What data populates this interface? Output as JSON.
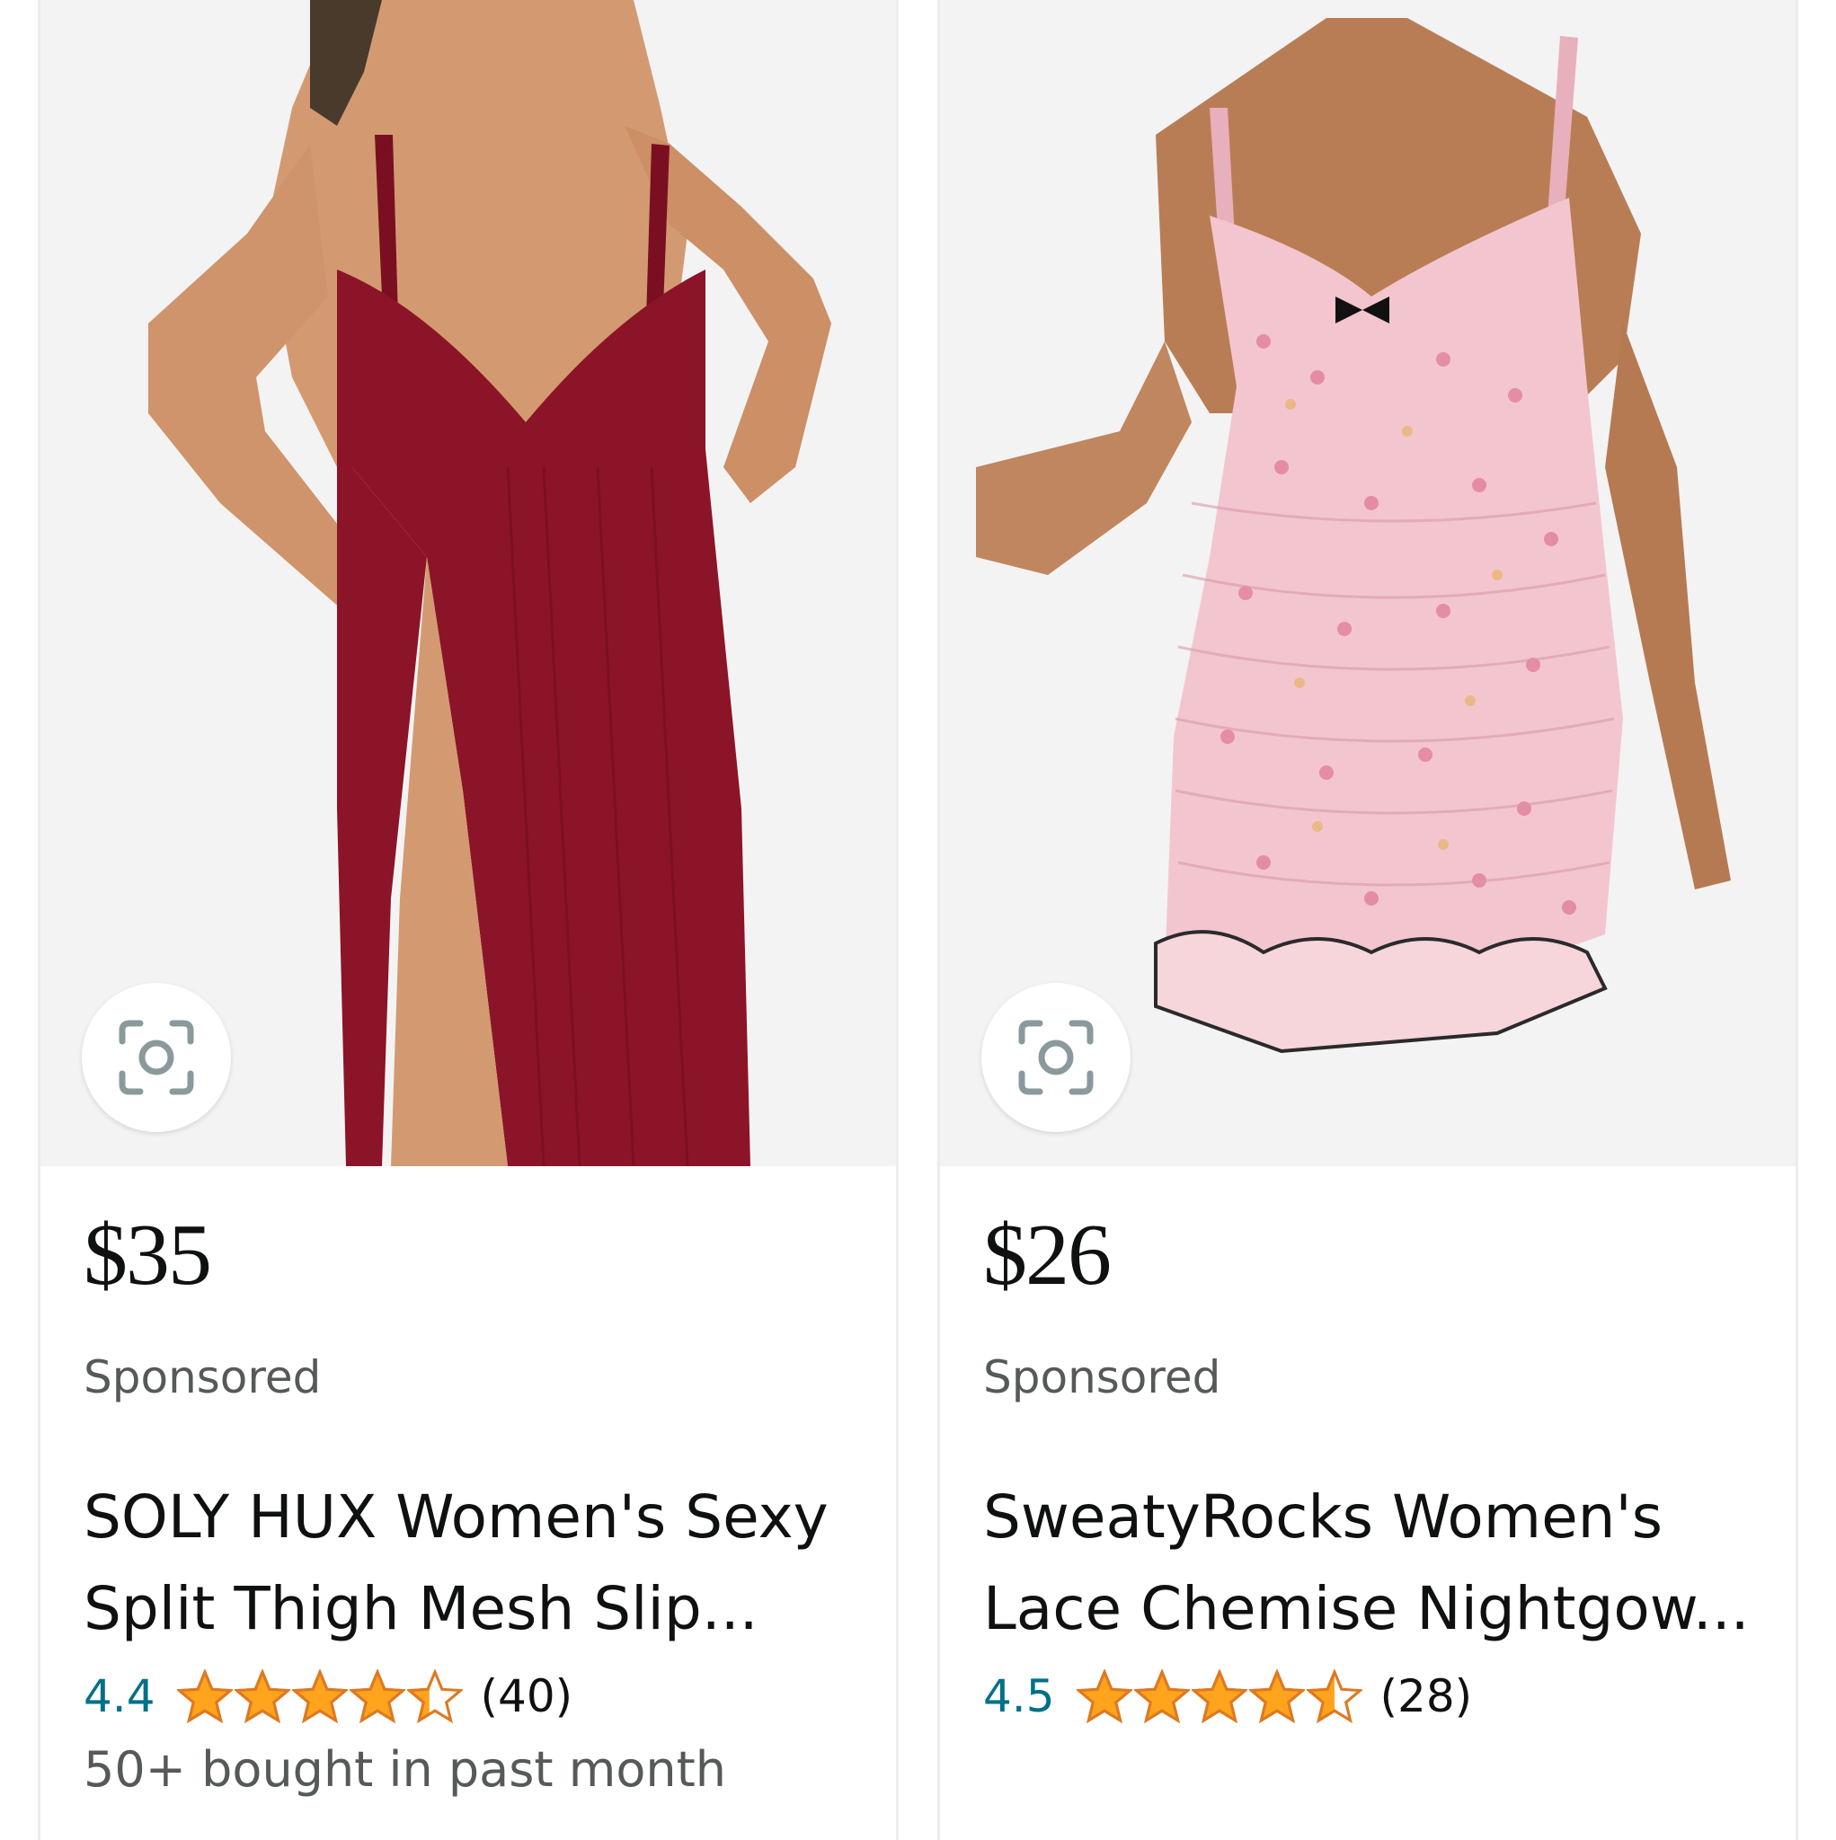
{
  "products": [
    {
      "price": "$35",
      "sponsored_label": "Sponsored",
      "title_line1": "SOLY HUX Women's Sexy",
      "title_line2": "Split Thigh Mesh Slip...",
      "rating": "4.4",
      "rating_value": 4.4,
      "reviews": "(40)",
      "bought": "50+ bought in past month",
      "image_desc": "red-mesh-slip-dress-photo",
      "dress_color": "#8c1428"
    },
    {
      "price": "$26",
      "sponsored_label": "Sponsored",
      "title_line1": "SweatyRocks Women's",
      "title_line2": "Lace Chemise Nightgow...",
      "rating": "4.5",
      "rating_value": 4.5,
      "reviews": "(28)",
      "bought": "",
      "image_desc": "pink-floral-ruched-chemise-photo",
      "dress_color": "#f3c6cf"
    }
  ],
  "colors": {
    "star_fill": "#ffa41c",
    "star_stroke": "#de7921",
    "rating_text": "#007185",
    "price_text": "#0f1111",
    "muted_text": "#565959"
  },
  "icons": {
    "visual_search": "camera-lens-icon",
    "star": "star-icon"
  }
}
